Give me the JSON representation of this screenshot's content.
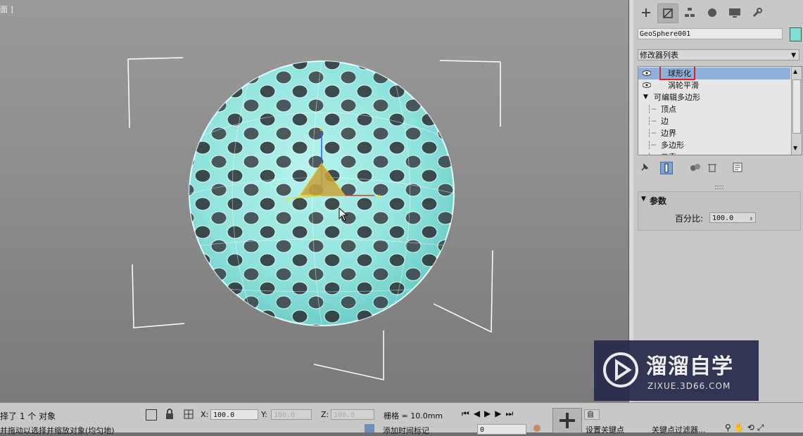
{
  "viewport": {
    "label": "面 ]"
  },
  "panel": {
    "tabs": [
      "create-icon",
      "modify-icon",
      "hierarchy-icon",
      "motion-icon",
      "display-icon",
      "utilities-icon"
    ],
    "object_name": "GeoSphere001",
    "object_color": "#7fe0d6",
    "modifier_list_label": "修改器列表",
    "stack": [
      {
        "label": "球形化",
        "selected": true,
        "eye": true
      },
      {
        "label": "涡轮平滑",
        "selected": false,
        "eye": true
      },
      {
        "label": "可编辑多边形",
        "selected": false,
        "eye": false
      },
      {
        "label": "顶点",
        "selected": false,
        "eye": false
      },
      {
        "label": "边",
        "selected": false,
        "eye": false
      },
      {
        "label": "边界",
        "selected": false,
        "eye": false
      },
      {
        "label": "多边形",
        "selected": false,
        "eye": false
      },
      {
        "label": "元素",
        "selected": false,
        "eye": false
      }
    ],
    "rollout": {
      "title": "参数",
      "percent_label": "百分比:",
      "percent_value": "100.0"
    }
  },
  "status": {
    "selection": "择了 1 个 对象",
    "hint": "并拖动以选择并缩放对象(均匀地)",
    "x_label": "X:",
    "x_value": "100.0",
    "y_label": "Y:",
    "y_value": "100.0",
    "z_label": "Z:",
    "z_value": "100.0",
    "grid": "栅格 = 10.0mm",
    "add_time_tag": "添加时间标记",
    "auto": "自",
    "set_key": "设置关键点",
    "key_filters": "关键点过滤器...",
    "frame_value": "0"
  },
  "watermark": {
    "title": "溜溜自学",
    "subtitle": "ZIXUE.3D66.COM"
  },
  "colors": {
    "accent_select": "#8fb0d8",
    "highlight_box": "#e0222b",
    "sphere": "#7fe0d6"
  }
}
